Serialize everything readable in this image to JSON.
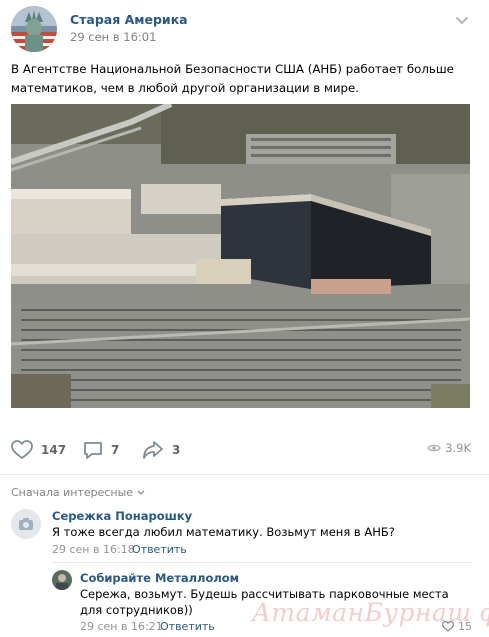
{
  "post": {
    "author": "Старая Америка",
    "date": "29 сен в 16:01",
    "text": "В Агентстве Национальной Безопасности США (АНБ) работает больше математиков, чем в любой другой организации в мире.",
    "photo_icon": "aerial-photo-nsa-headquarters",
    "avatar_icon": "statue-of-liberty-avatar",
    "menu_icon": "chevron-down-icon"
  },
  "actions": {
    "likes": "147",
    "comments": "7",
    "shares": "3",
    "views": "3.9K"
  },
  "comments_sort": "Сначала интересные",
  "comments": [
    {
      "author": "Сережка Понарошку",
      "text": "Я тоже всегда любил математику. Возьмут меня в АНБ?",
      "date": "29 сен в 16:18",
      "reply": "Ответить",
      "avatar_icon": "camera-placeholder-avatar"
    },
    {
      "author": "Собирайте Металлолом",
      "text": "Сережа, возьмут. Будешь рассчитывать парковочные места для сотрудников))",
      "date": "29 сен в 16:21",
      "reply": "Ответить",
      "likes": "15",
      "avatar_icon": "user-photo-avatar"
    }
  ],
  "watermark": "АтаманБурнаш фор.Ru",
  "colors": {
    "link": "#2a5885",
    "muted": "#828282",
    "icon": "#818c99",
    "divider": "#e7e8ec"
  }
}
